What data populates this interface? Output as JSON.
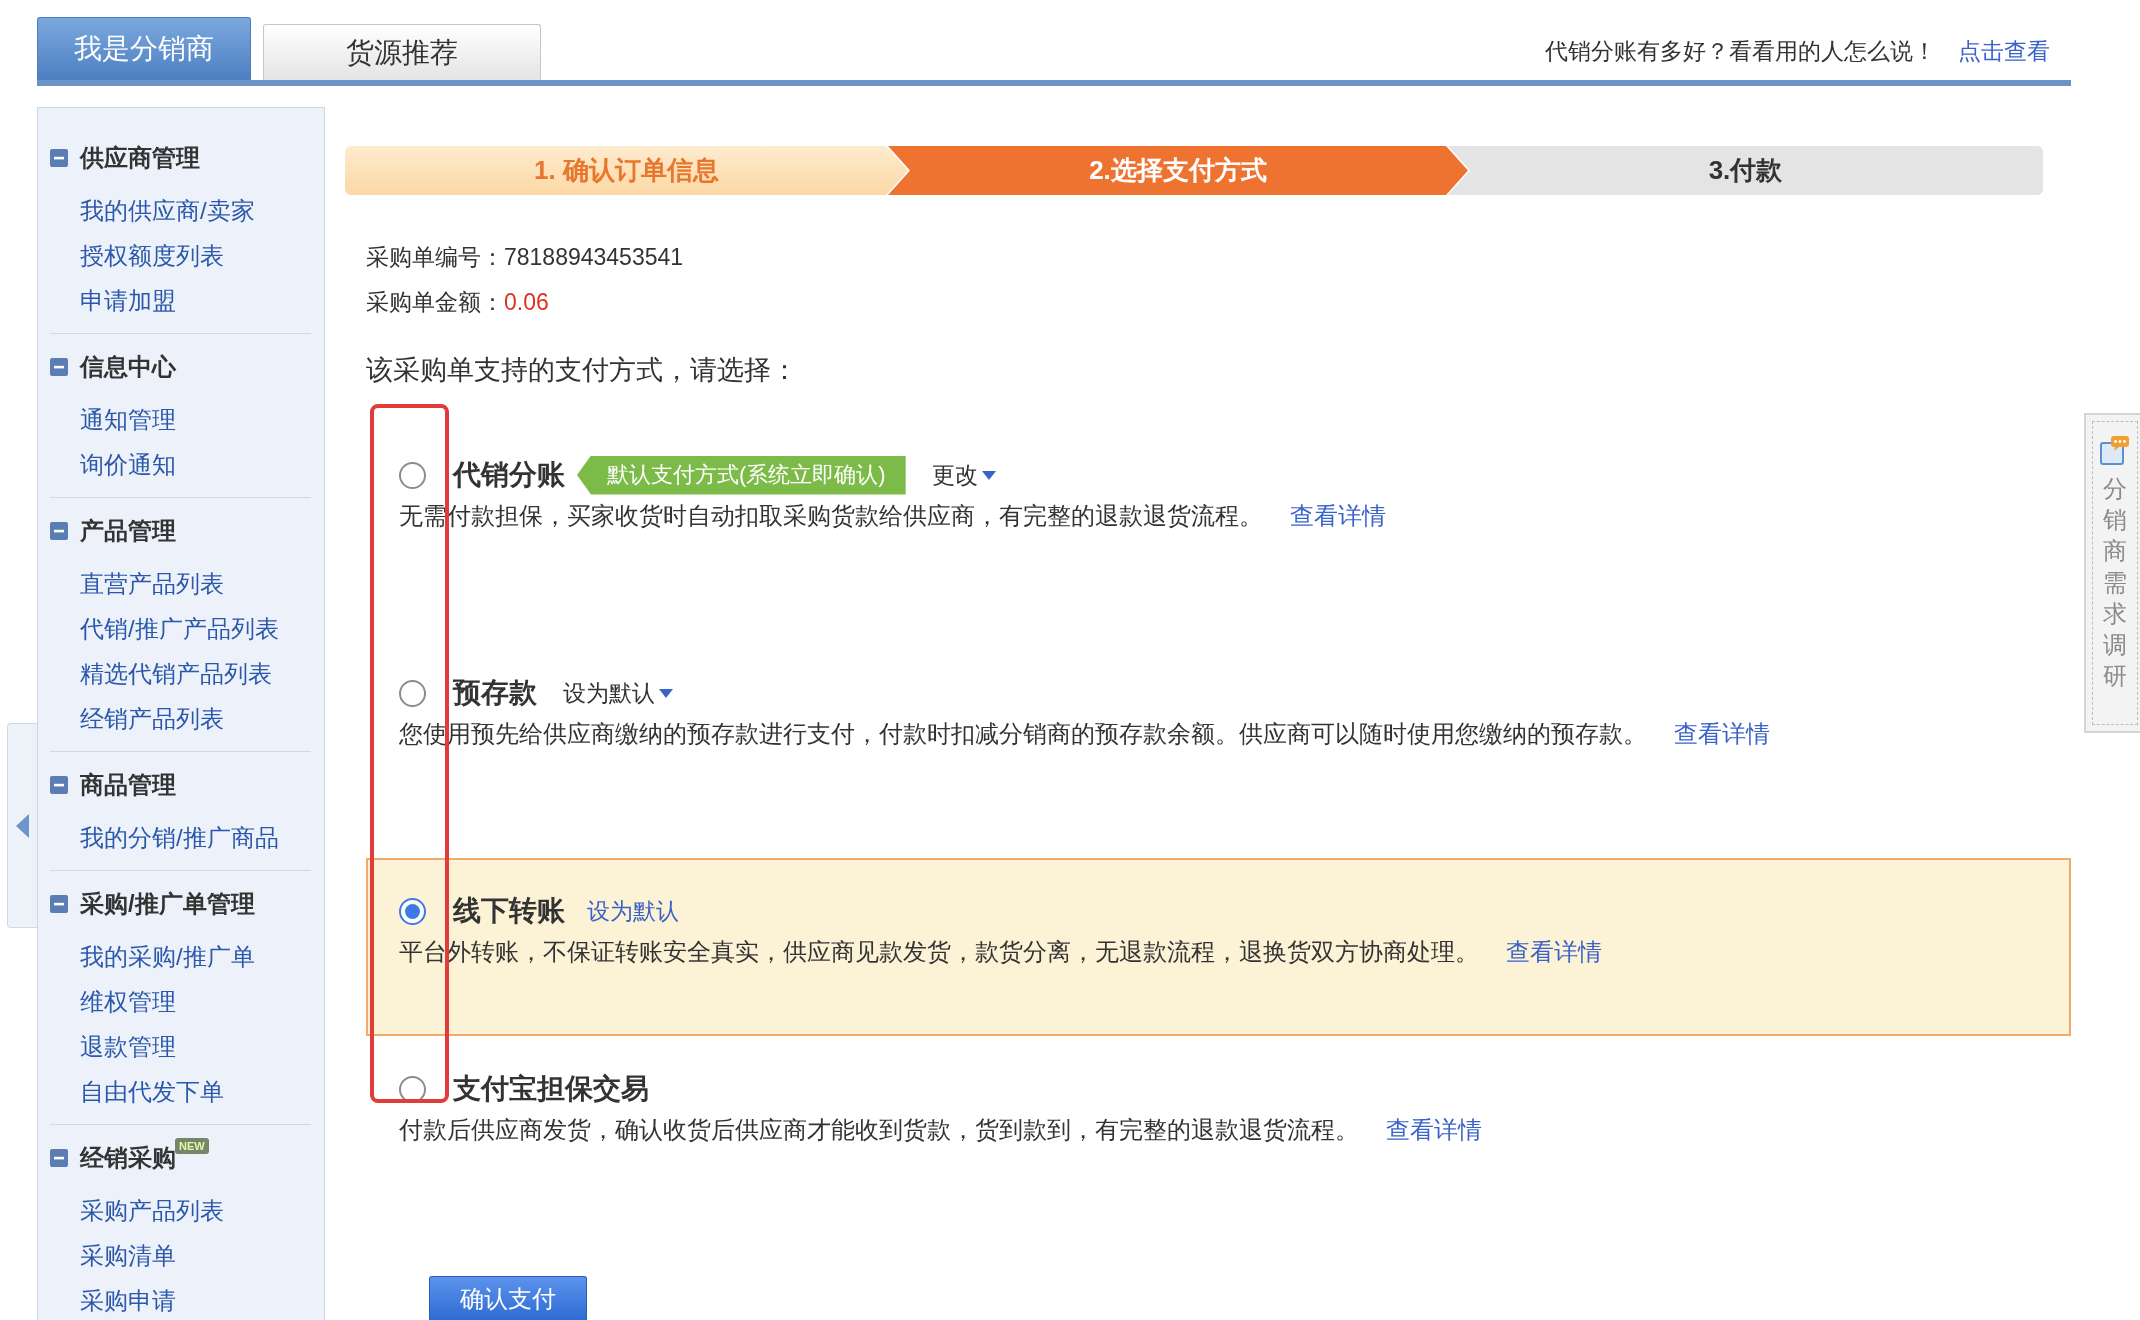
{
  "tabs": [
    {
      "label": "我是分销商",
      "selected": true
    },
    {
      "label": "货源推荐",
      "selected": false
    }
  ],
  "promo": {
    "text": "代销分账有多好？看看用的人怎么说！",
    "link": "点击查看"
  },
  "sidebar": {
    "groups": [
      {
        "title": "供应商管理",
        "expanded": true,
        "items": [
          "我的供应商/卖家",
          "授权额度列表",
          "申请加盟"
        ]
      },
      {
        "title": "信息中心",
        "expanded": true,
        "items": [
          "通知管理",
          "询价通知"
        ]
      },
      {
        "title": "产品管理",
        "expanded": true,
        "items": [
          "直营产品列表",
          "代销/推广产品列表",
          "精选代销产品列表",
          "经销产品列表"
        ]
      },
      {
        "title": "商品管理",
        "expanded": true,
        "items": [
          "我的分销/推广商品"
        ]
      },
      {
        "title": "采购/推广单管理",
        "expanded": true,
        "items": [
          "我的采购/推广单",
          "维权管理",
          "退款管理",
          "自由代发下单"
        ]
      },
      {
        "title": "经销采购",
        "badge": "NEW",
        "expanded": true,
        "items": [
          "采购产品列表",
          "采购清单",
          "采购申请"
        ]
      }
    ]
  },
  "steps": [
    {
      "label": "1. 确认订单信息",
      "done": true,
      "current": false
    },
    {
      "label": "2.选择支付方式",
      "done": false,
      "current": true
    },
    {
      "label": "3.付款",
      "done": false,
      "current": false
    }
  ],
  "order": {
    "fields": [
      {
        "label": "采购单编号：",
        "value": "78188943453541",
        "kind": "plain"
      },
      {
        "label": "采购单金额：",
        "value": "0.06",
        "kind": "amount"
      }
    ]
  },
  "payment": {
    "prompt": "该采购单支持的支付方式，请选择：",
    "options": [
      {
        "title": "代销分账",
        "selected": false,
        "badge": "默认支付方式(系统立即确认)",
        "action": {
          "kind": "dropdown",
          "label": "更改"
        },
        "description": "无需付款担保，买家收货时自动扣取采购货款给供应商，有完整的退款退货流程。",
        "link": "查看详情"
      },
      {
        "title": "预存款",
        "selected": false,
        "action": {
          "kind": "dropdown",
          "label": "设为默认"
        },
        "description": "您使用预先给供应商缴纳的预存款进行支付，付款时扣减分销商的预存款余额。供应商可以随时使用您缴纳的预存款。",
        "link": "查看详情"
      },
      {
        "title": "线下转账",
        "selected": true,
        "action": {
          "kind": "link",
          "label": "设为默认"
        },
        "description": "平台外转账，不保证转账安全真实，供应商见款发货，款货分离，无退款流程，退换货双方协商处理。",
        "link": "查看详情"
      },
      {
        "title": "支付宝担保交易",
        "selected": false,
        "description": "付款后供应商发货，确认收货后供应商才能收到货款，货到款到，有完整的退款退货流程。",
        "link": "查看详情"
      }
    ]
  },
  "submit_button": "确认支付",
  "side_tab": {
    "label": "分销商需求调研"
  }
}
